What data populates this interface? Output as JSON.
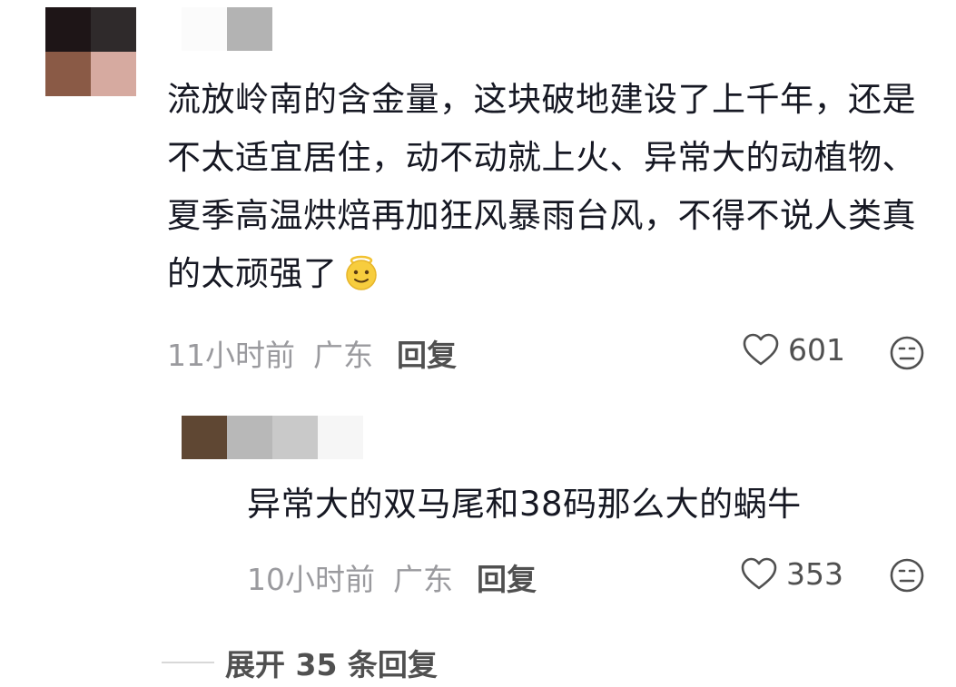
{
  "comment": {
    "text": "流放岭南的含金量，这块破地建设了上千年，还是不太适宜居住，动不动就上火、异常大的动植物、夏季高温烘焙再加狂风暴雨台风，不得不说人类真的太顽强了",
    "emoji_icon": "smiling-face-with-halo-icon",
    "time": "11小时前",
    "region": "广东",
    "reply_label": "回复",
    "like_count": "601",
    "avatar_colors": [
      "#1e1517",
      "#2f2a2b",
      "#8a5a46",
      "#d6aaa0"
    ]
  },
  "reply": {
    "text": "异常大的双马尾和38码那么大的蜗牛",
    "time": "10小时前",
    "region": "广东",
    "reply_label": "回复",
    "like_count": "353",
    "avatar_color": "#5f4733"
  },
  "expand": {
    "label": "展开 35 条回复"
  },
  "colors": {
    "primary_text": "#161823",
    "meta_text": "#9a9a9e",
    "action_text": "#505050",
    "background": "#ffffff"
  }
}
